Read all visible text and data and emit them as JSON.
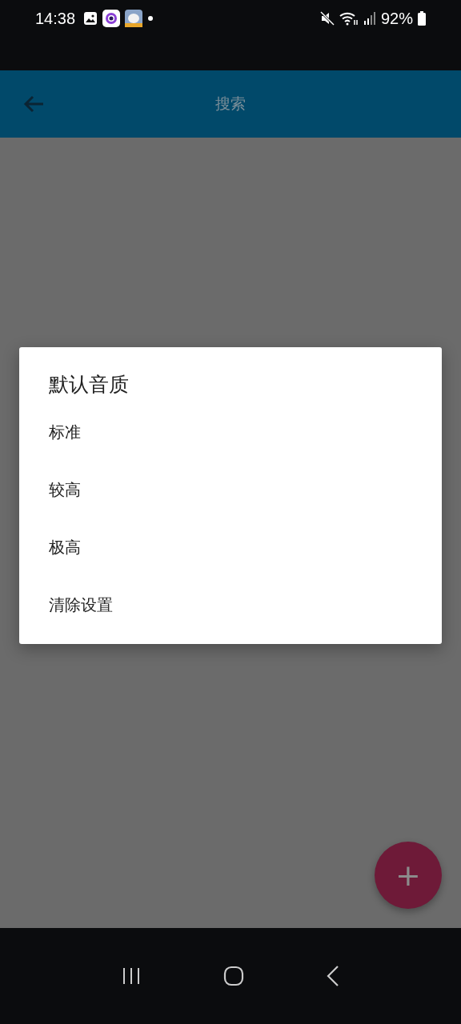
{
  "status_bar": {
    "time": "14:38",
    "battery": "92%"
  },
  "app_bar": {
    "title": "搜索"
  },
  "dialog": {
    "title": "默认音质",
    "options": [
      {
        "label": "标准"
      },
      {
        "label": "较高"
      },
      {
        "label": "极高"
      },
      {
        "label": "清除设置"
      }
    ]
  },
  "fab": {
    "label": "+"
  }
}
